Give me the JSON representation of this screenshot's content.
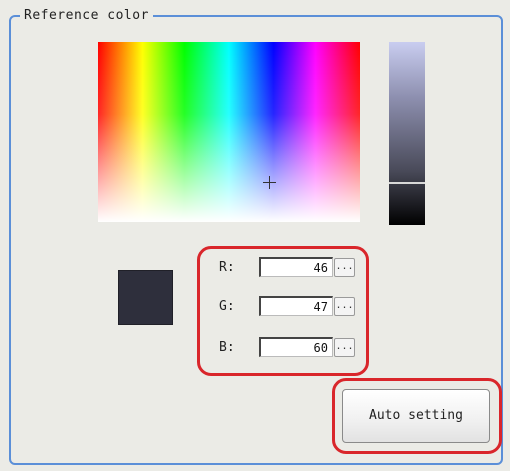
{
  "group": {
    "title": "Reference color"
  },
  "color": {
    "r_label": "R:",
    "r_value": "46",
    "g_label": "G:",
    "g_value": "47",
    "b_label": "B:",
    "b_value": "60",
    "more_label": "...",
    "swatch_hex": "#2e2f3c"
  },
  "buttons": {
    "auto_setting": "Auto setting"
  },
  "highlight_color": "#d9262b",
  "group_border_color": "#5b8fd8"
}
